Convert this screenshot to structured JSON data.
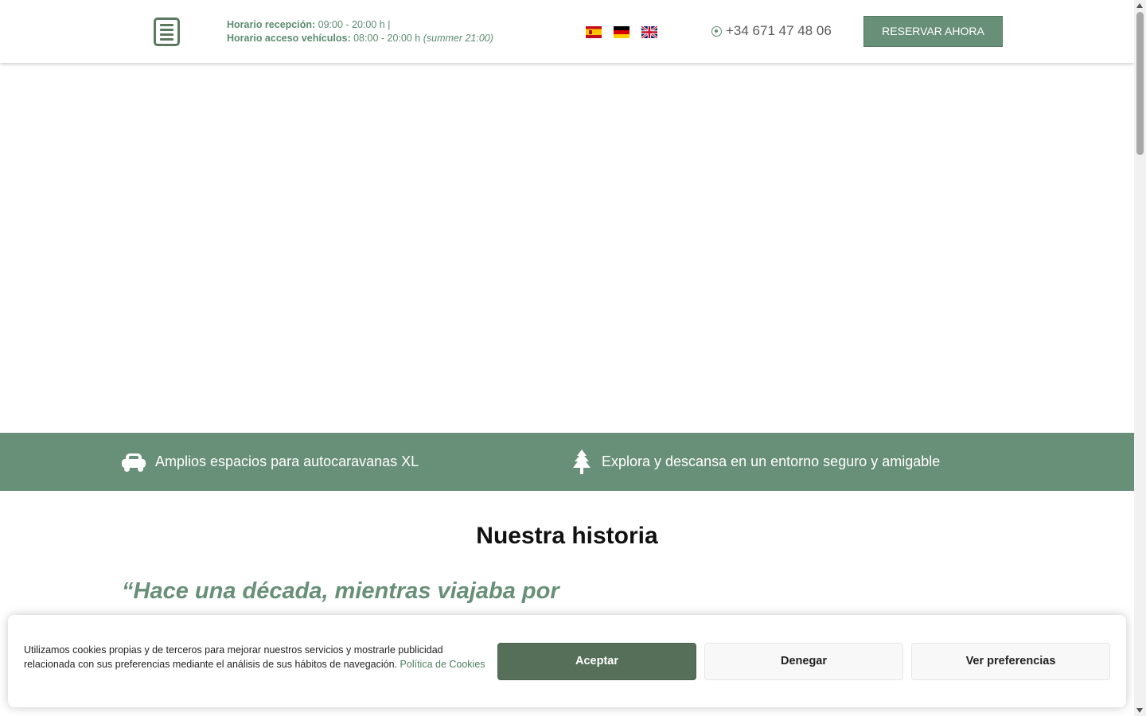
{
  "header": {
    "reception_label": "Horario recepción:",
    "reception_value": "09:00 - 20:00 h |",
    "vehicles_label": "Horario acceso vehículos:",
    "vehicles_value": "08:00 - 20:00 h",
    "vehicles_summer": "(summer 21:00)",
    "languages": [
      "es",
      "de",
      "en"
    ],
    "phone": "+34 671 47 48 06",
    "reserve_label": "RESERVAR AHORA"
  },
  "features": [
    {
      "icon": "car-icon",
      "text": "Amplios espacios para autocaravanas XL"
    },
    {
      "icon": "tree-icon",
      "text": "Explora y descansa en un entorno seguro y amigable"
    }
  ],
  "story": {
    "title": "Nuestra historia",
    "quote": "“Hace una década, mientras viajaba por"
  },
  "cookies": {
    "text": "Utilizamos cookies propias y de terceros para mejorar nuestros servicios y mostrarle publicidad relacionada con sus preferencias mediante el análisis de sus hábitos de navegación.",
    "policy_link": " Política de Cookies ",
    "accept_label": "Aceptar",
    "deny_label": "Denegar",
    "prefs_label": "Ver preferencias"
  },
  "colors": {
    "brand_green": "#688f77",
    "dark_green": "#566f58",
    "text_green": "#5b8c6e"
  }
}
